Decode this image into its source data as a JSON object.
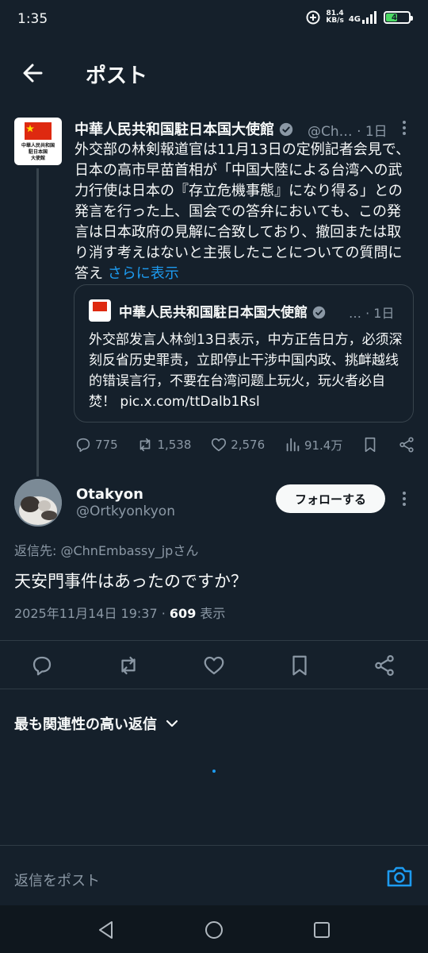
{
  "status_bar": {
    "time": "1:35",
    "net_speed_value": "81.4",
    "net_speed_unit": "KB/s",
    "network": "4G",
    "battery": "47"
  },
  "header": {
    "title": "ポスト"
  },
  "thread_post": {
    "avatar_text": [
      "中華人民共和国",
      "駐日本国",
      "大使館"
    ],
    "author_name": "中華人民共和国駐日本国大使館",
    "handle": "@Ch…",
    "time": "· 1日",
    "text": "外交部の林剣報道官は11月13日の定例記者会見で、日本の高市早苗首相が「中国大陸による台湾への武力行使は日本の『存立危機事態』になり得る」との発言を行った上、国会での答弁においても、この発言は日本政府の見解に合致しており、撤回または取り消す考えはないと主張したことについての質問に答え",
    "show_more": "さらに表示",
    "quote": {
      "author_name": "中華人民共和国駐日本国大使館",
      "meta": "… · 1日",
      "text": "外交部发言人林剑13日表示，中方正告日方，必须深刻反省历史罪责，立即停止干涉中国内政、挑衅越线的错误言行，不要在台湾问题上玩火，玩火者必自焚！",
      "link": "pic.x.com/ttDalb1Rsl"
    },
    "stats": {
      "replies": "775",
      "reposts": "1,538",
      "likes": "2,576",
      "views": "91.4万"
    }
  },
  "main_post": {
    "author_name": "Otakyon",
    "handle": "@Ortkyonkyon",
    "follow_label": "フォローする",
    "reply_to_prefix": "返信先: ",
    "reply_to_handle": "@ChnEmbassy_jp",
    "reply_to_suffix": "さん",
    "text": "天安門事件はあったのですか？",
    "timestamp": "2025年11月14日 19:37",
    "separator": "·",
    "views_count": "609",
    "views_label": "表示"
  },
  "replies_sort": {
    "label": "最も関連性の高い返信"
  },
  "reply_bar": {
    "placeholder": "返信をポスト"
  },
  "colors": {
    "background": "#15202b",
    "accent": "#1d9bf0",
    "muted": "#8b98a5",
    "border": "#38444d",
    "verified": "#8b98a5"
  },
  "icons": [
    "back-arrow-icon",
    "more-vertical-icon",
    "verified-badge-icon",
    "reply-icon",
    "repost-icon",
    "like-icon",
    "views-icon",
    "bookmark-icon",
    "share-icon",
    "chevron-down-icon",
    "camera-icon",
    "nav-back-icon",
    "nav-home-icon",
    "nav-recents-icon"
  ]
}
